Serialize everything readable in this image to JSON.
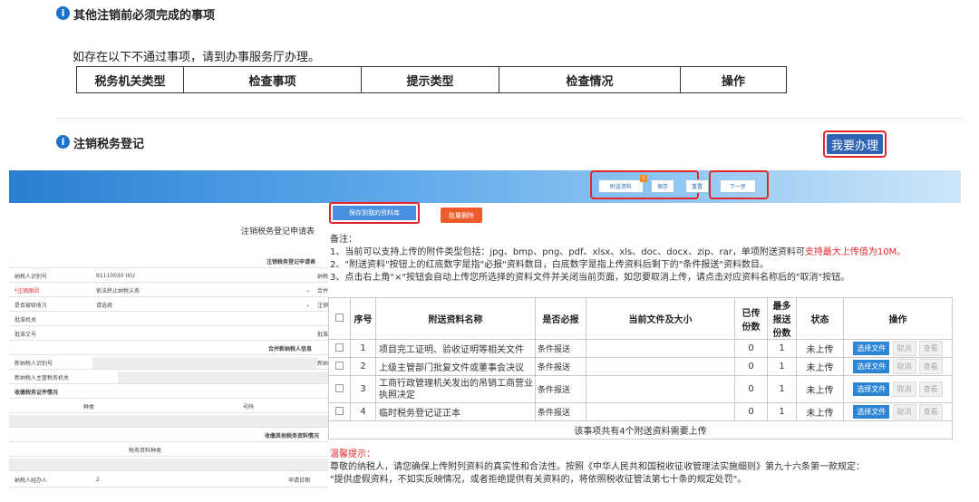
{
  "section1": {
    "title": "其他注销前必须完成的事项",
    "note": "如存在以下不通过事项，请到办事服务厅办理。",
    "columns": [
      "税务机关类型",
      "检查事项",
      "提示类型",
      "检查情况",
      "操作"
    ]
  },
  "section2": {
    "title": "注销税务登记",
    "go_button": "我要办理"
  },
  "toolbar": {
    "attach_btn": "附送资料",
    "attach_badge": "1",
    "save_btn": "保存",
    "reset_btn": "重置",
    "next_btn": "下一步"
  },
  "form": {
    "title": "注销税务登记申请表",
    "subheader": "注销税务登记申请表",
    "rows": [
      {
        "label": "纳税人识别号",
        "value": "91110030        IXU",
        "extra": "纳税"
      },
      {
        "label": "*注销原因",
        "value": "依法终止纳税义务",
        "extra": "合并"
      },
      {
        "label": "是否被吸收方",
        "value": "请选择",
        "extra": "注销"
      },
      {
        "label": "批准机关",
        "value": "",
        "extra": ""
      },
      {
        "label": "批准文号",
        "value": "",
        "extra": "批准"
      }
    ],
    "merge_header": "合并新纳税人信息",
    "merge_rows": [
      {
        "label": "新纳税人识别号",
        "extra": "新纳"
      },
      {
        "label": "新纳税人主管税务机关",
        "extra": ""
      }
    ],
    "cert_header": "收缴税务证件情况",
    "cert_cols": [
      "种类",
      "号码"
    ],
    "invoice_header": "收缴其他税务资料情况",
    "invoice_col": "税务资料种类",
    "handler_label": "纳税人经办人",
    "handler_value": "2",
    "apply_date_label": "申请日期"
  },
  "upload": {
    "save_to_lib": "保存到我的资料库",
    "batch_delete": "批量删除",
    "note_title": "备注：",
    "note1": "1、当前可以支持上传的附件类型包括：jpg、bmp、png、pdf、xlsx、xls、doc、docx、zip、rar，单项附送资料可",
    "note1_red": "支持最大上传值为10M。",
    "note2": "2、\"附送资料\"按钮上的红底数字是指\"必报\"资料数目，白底数字是指上传资料后剩下的\"条件报送\"资料数目。",
    "note3": "3、点击右上角\"×\"按钮会自动上传您所选择的资料文件并关闭当前页面，如您要取消上传，请点击对应资料名称后的\"取消\"按钮。",
    "columns": [
      "序号",
      "附送资料名称",
      "是否必报",
      "当前文件及大小",
      "已传份数",
      "最多报送份数",
      "状态",
      "操作"
    ],
    "rows": [
      {
        "no": "1",
        "name": "项目完工证明、验收证明等相关文件",
        "required": "条件报送",
        "file": "",
        "uploaded": "0",
        "max": "1",
        "status": "未上传"
      },
      {
        "no": "2",
        "name": "上级主管部门批复文件或董事会决议",
        "required": "条件报送",
        "file": "",
        "uploaded": "0",
        "max": "1",
        "status": "未上传"
      },
      {
        "no": "3",
        "name": "工商行政管理机关发出的吊销工商营业执照决定",
        "required": "条件报送",
        "file": "",
        "uploaded": "0",
        "max": "1",
        "status": "未上传"
      },
      {
        "no": "4",
        "name": "临时税务登记证正本",
        "required": "条件报送",
        "file": "",
        "uploaded": "0",
        "max": "1",
        "status": "未上传"
      }
    ],
    "btn_choose": "选择文件",
    "btn_cancel": "取消",
    "btn_view": "查看",
    "summary": "该事项共有4个附送资料需要上传",
    "tip_title": "温馨提示：",
    "tip1": "尊敬的纳税人，请您确保上传附列资料的真实性和合法性。按照《中华人民共和国税收征收管理法实施细则》第九十六条第一款规定：",
    "tip2": "\"提供虚假资料，不如实反映情况，或者拒绝提供有关资料的，将依照税收征管法第七十条的规定处罚\"。"
  },
  "colors": {
    "accent": "#2d64b3",
    "highlight": "#e3262e"
  }
}
